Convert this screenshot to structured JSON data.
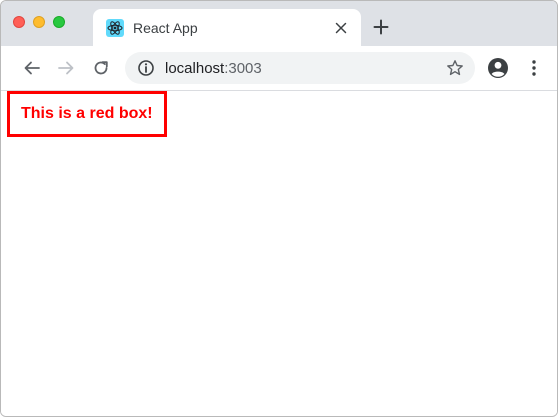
{
  "tab": {
    "title": "React App"
  },
  "address_bar": {
    "host": "localhost",
    "port": ":3003"
  },
  "page": {
    "red_box_text": "This is a red box!"
  },
  "colors": {
    "accent": "#ff0000",
    "tabstrip": "#dee1e6",
    "omnibox": "#f1f3f4"
  },
  "icons": {
    "favicon": "react-logo-icon",
    "close": "close-icon",
    "new_tab": "plus-icon",
    "back": "back-arrow-icon",
    "forward": "forward-arrow-icon",
    "reload": "reload-icon",
    "info": "info-icon",
    "bookmark": "star-icon",
    "profile": "account-circle-icon",
    "menu": "kebab-menu-icon"
  }
}
